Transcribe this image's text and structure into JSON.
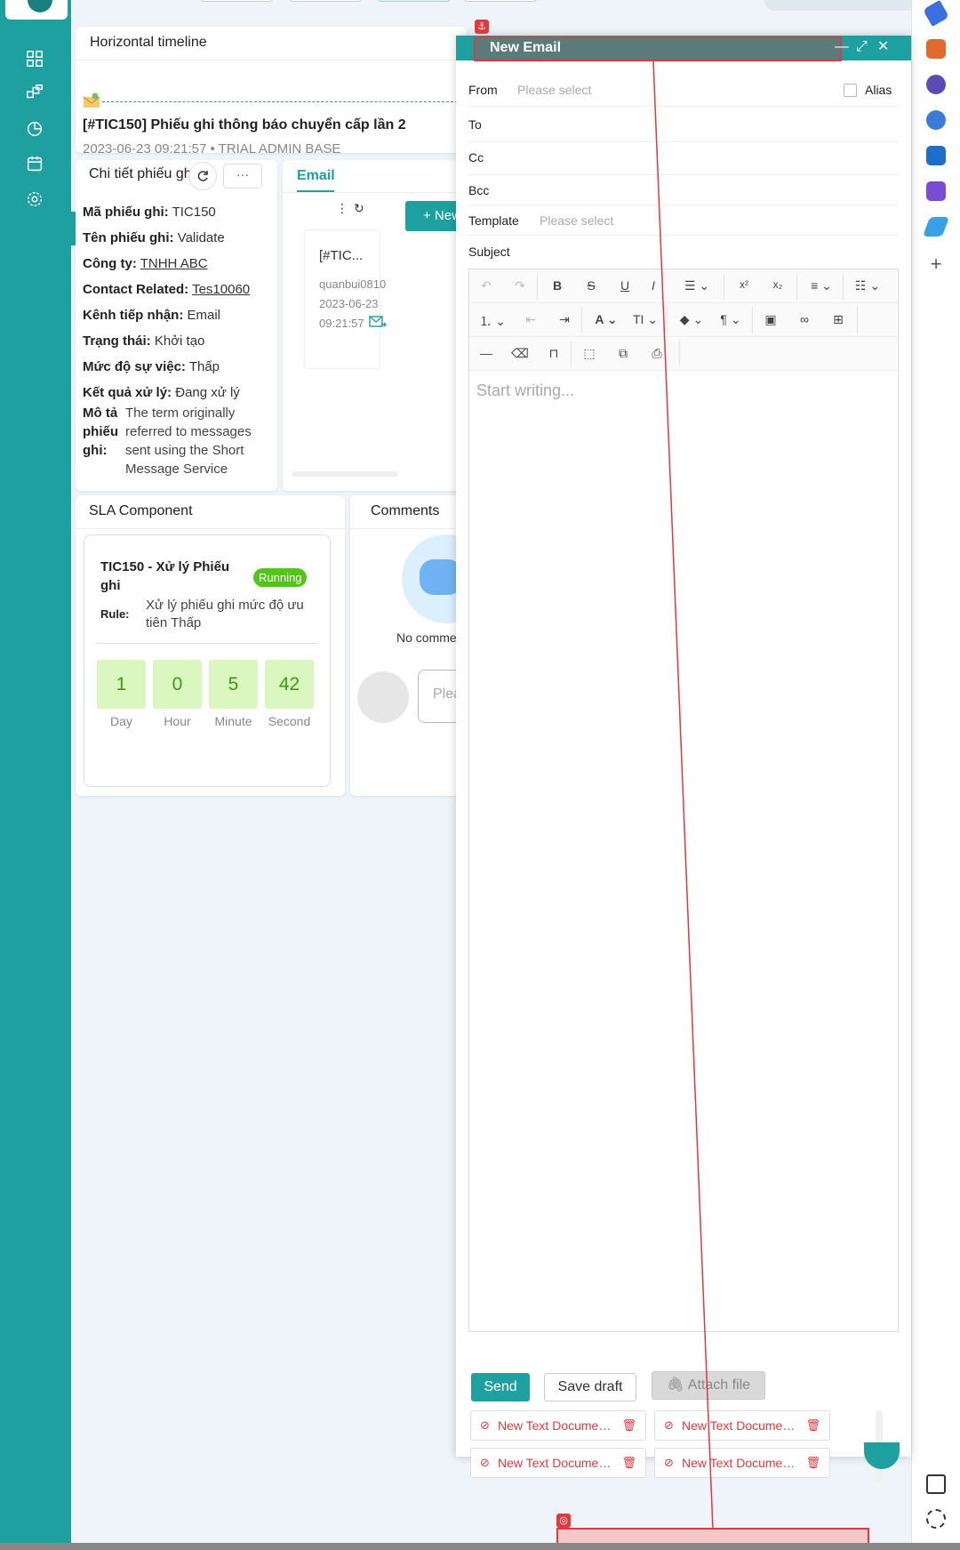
{
  "timeline": {
    "title": "Horizontal timeline",
    "item_title": "[#TIC150] Phiếu ghi thông báo chuyển cấp lần 2",
    "item_meta": "2023-06-23 09:21:57 • TRIAL ADMIN BASE"
  },
  "detail": {
    "title": "Chi tiết phiếu ghi",
    "more_label": "···",
    "rows": [
      {
        "label": "Mã phiếu ghi:",
        "value": "TIC150"
      },
      {
        "label": "Tên phiếu ghi:",
        "value": "Validate"
      },
      {
        "label": "Công ty:",
        "value": "TNHH ABC"
      },
      {
        "label": "Contact Related:",
        "value": "Tes10060"
      },
      {
        "label": "Kênh tiếp nhận:",
        "value": "Email"
      },
      {
        "label": "Trạng thái:",
        "value": "Khởi tạo"
      },
      {
        "label": "Mức độ sự việc:",
        "value": "Thấp"
      },
      {
        "label": "Kết quả xử lý:",
        "value": "Đang xử lý"
      }
    ],
    "desc_label": "Mô tả phiếu ghi:",
    "desc_value": "The term originally referred to messages sent using the Short Message Service"
  },
  "email_panel": {
    "tab": "Email",
    "new_button": "+ New",
    "item_title": "[#TIC...",
    "item_sender": "quanbui0810",
    "item_date": "2023-06-23",
    "item_time": "09:21:57"
  },
  "sla": {
    "title": "SLA Component",
    "name": "TIC150 - Xử lý Phiếu ghi",
    "status": "Running",
    "rule_label": "Rule:",
    "rule_value": "Xử lý phiếu ghi mức độ ưu tiên Thấp",
    "counters": [
      {
        "value": "1",
        "label": "Day"
      },
      {
        "value": "0",
        "label": "Hour"
      },
      {
        "value": "5",
        "label": "Minute"
      },
      {
        "value": "42",
        "label": "Second"
      }
    ]
  },
  "comments": {
    "title": "Comments",
    "empty": "No comments",
    "input_placeholder": "Please"
  },
  "compose": {
    "title": "New Email",
    "from_label": "From",
    "from_placeholder": "Please select",
    "alias_label": "Alias",
    "to_label": "To",
    "cc_label": "Cc",
    "bcc_label": "Bcc",
    "template_label": "Template",
    "template_placeholder": "Please select",
    "subject_label": "Subject",
    "editor_placeholder": "Start writing...",
    "send": "Send",
    "save_draft": "Save draft",
    "attach": "Attach file",
    "attachments": [
      "New Text Document.txt",
      "New Text Document.txt",
      "New Text Document.txt",
      "New Text Document.txt"
    ]
  },
  "colors": {
    "brand": "#1fa0a0",
    "annotation": "#e0393e",
    "running": "#52c41a"
  }
}
